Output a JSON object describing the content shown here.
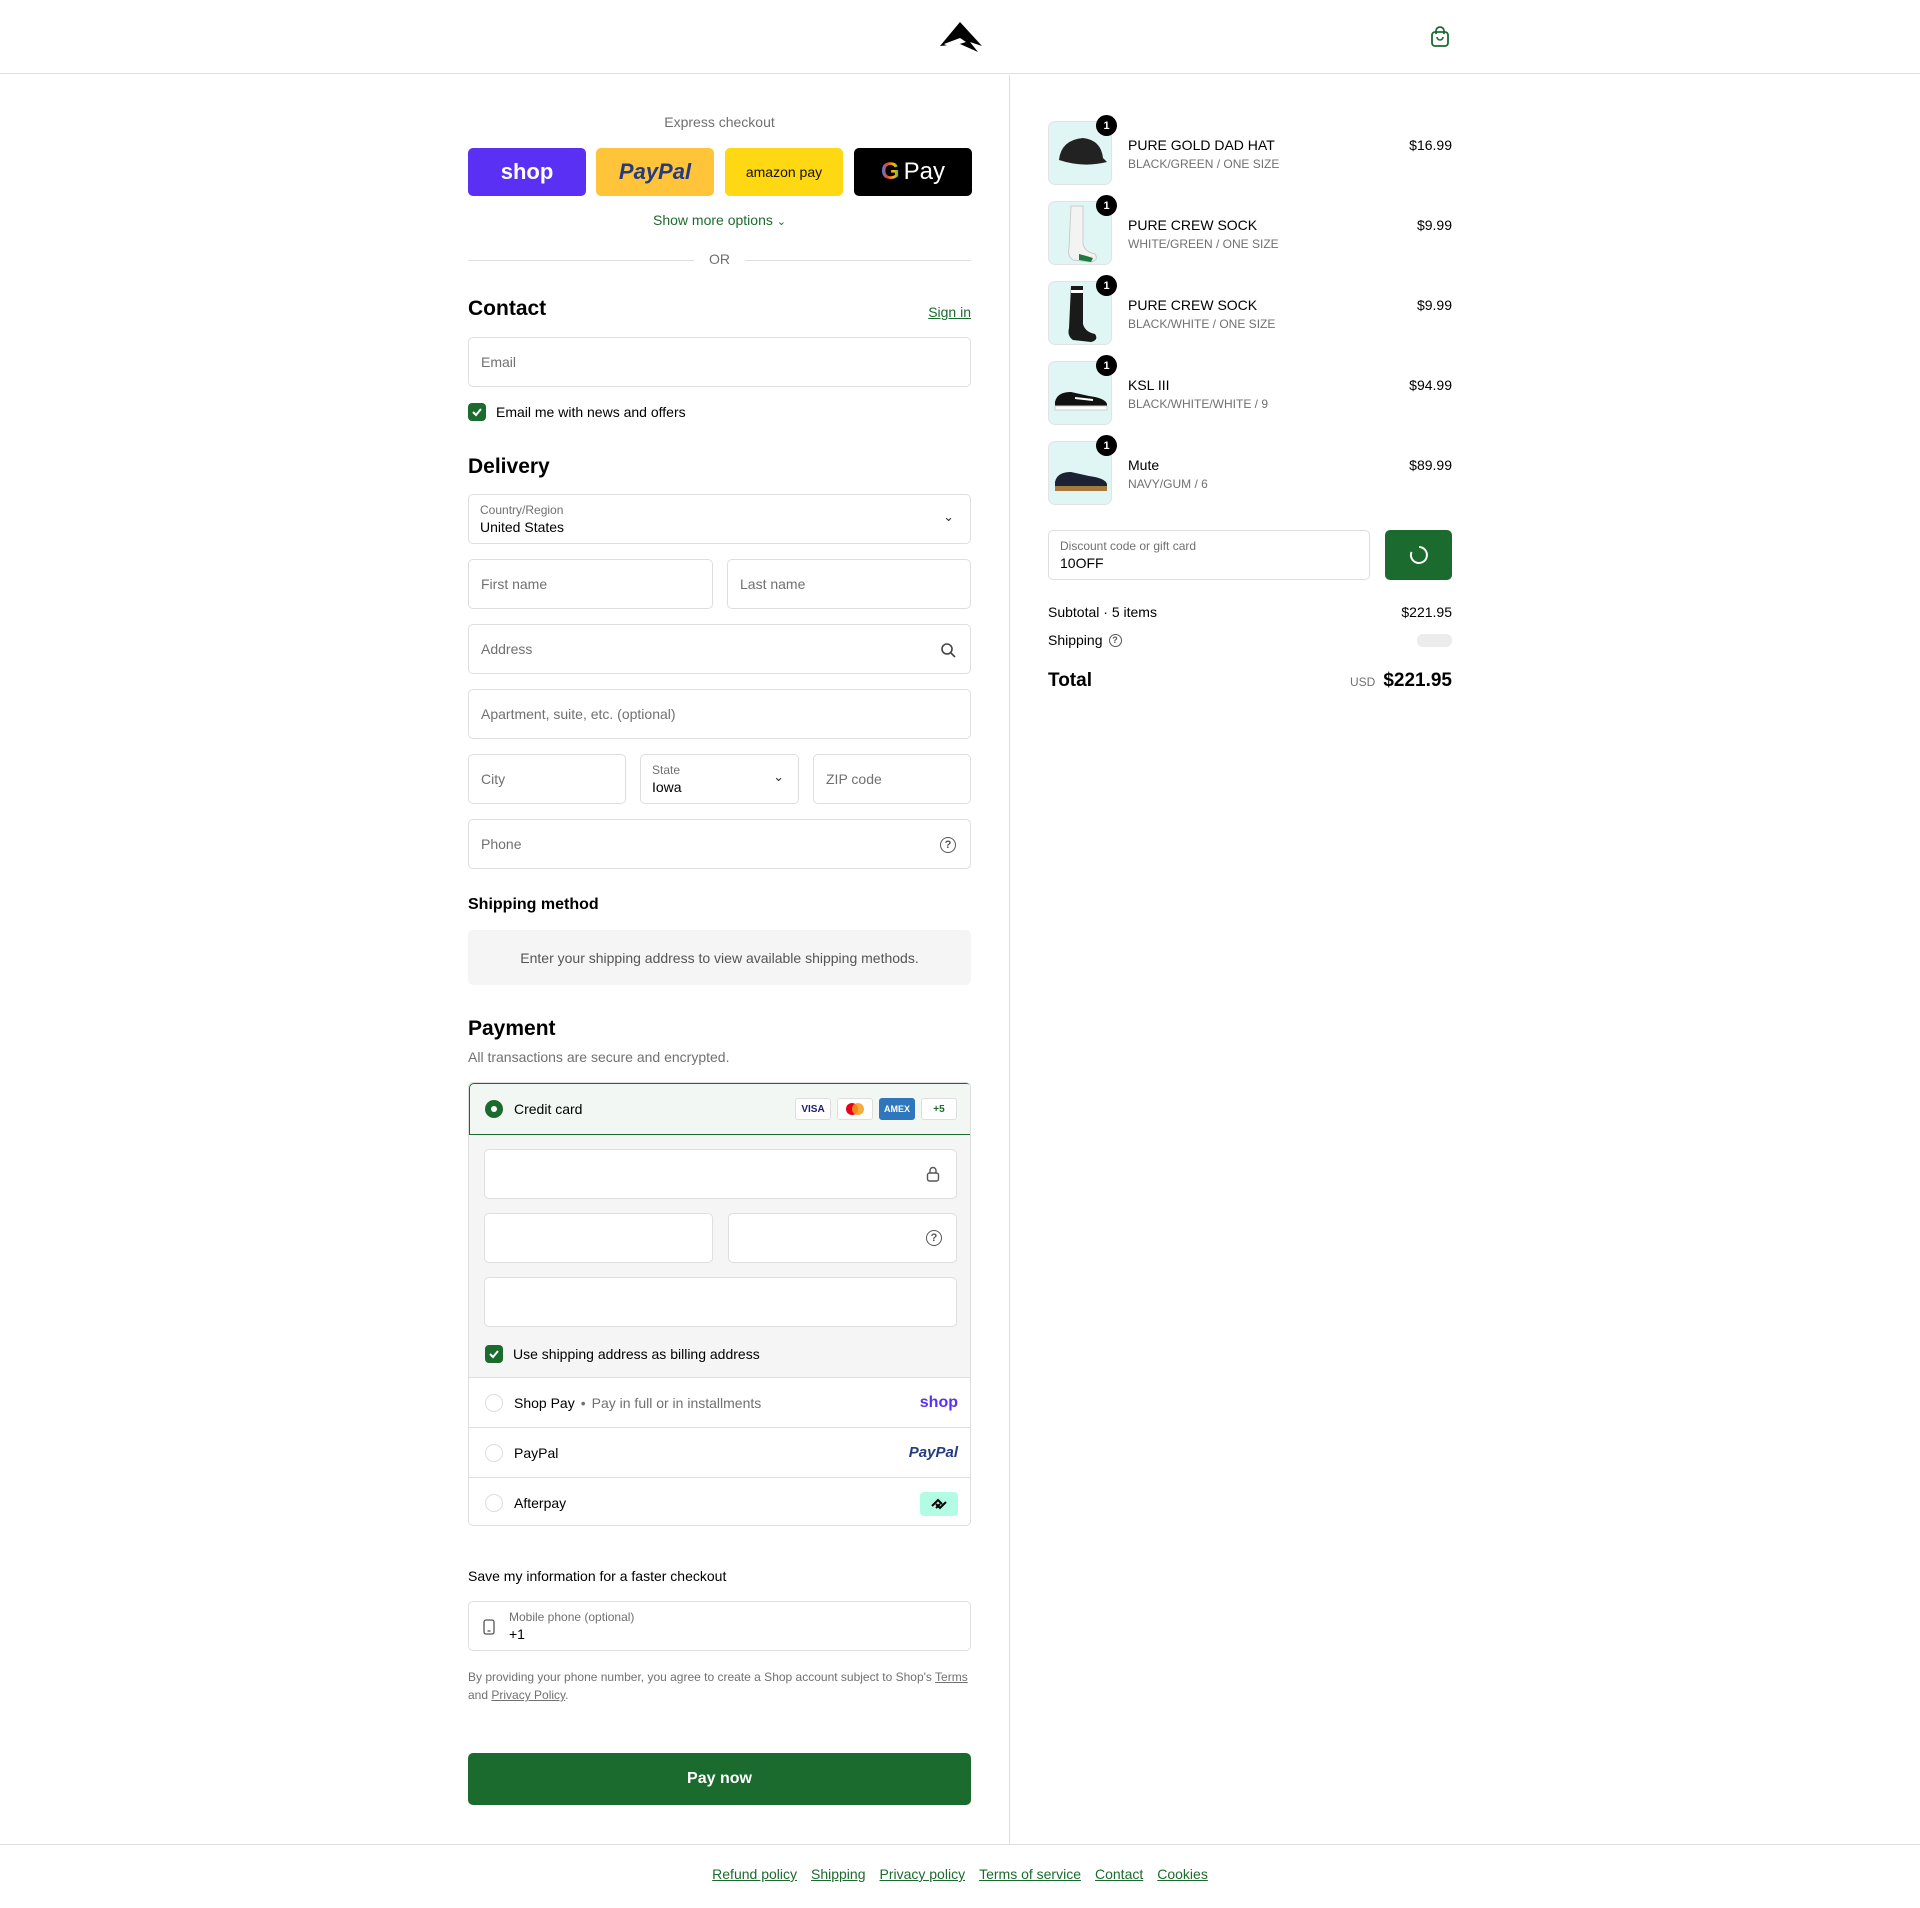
{
  "colors": {
    "accent": "#1c6b2e",
    "shop_purple": "#5a31f4",
    "paypal_yellow": "#ffc439",
    "amazon_yellow": "#ffd814",
    "thumb_bg": "#dff6f4"
  },
  "express": {
    "label": "Express checkout",
    "shop": "shop",
    "paypal": "PayPal",
    "amazon": "amazon pay",
    "gpay": "Pay",
    "more": "Show more options",
    "or": "OR"
  },
  "contact": {
    "title": "Contact",
    "sign_in": "Sign in",
    "email_placeholder": "Email",
    "news_label": "Email me with news and offers"
  },
  "delivery": {
    "title": "Delivery",
    "country_label": "Country/Region",
    "country_value": "United States",
    "first_name": "First name",
    "last_name": "Last name",
    "address": "Address",
    "apartment": "Apartment, suite, etc. (optional)",
    "city": "City",
    "state_label": "State",
    "state_value": "Iowa",
    "zip": "ZIP code",
    "phone": "Phone"
  },
  "shipping_method": {
    "title": "Shipping method",
    "message": "Enter your shipping address to view available shipping methods."
  },
  "payment": {
    "title": "Payment",
    "subtitle": "All transactions are secure and encrypted.",
    "credit_card": "Credit card",
    "card_logos": [
      "VISA",
      "",
      "AMEX",
      "+5"
    ],
    "billing_label": "Use shipping address as billing address",
    "shop_pay": "Shop Pay",
    "shop_pay_sub": "Pay in full or in installments",
    "shop_logo": "shop",
    "paypal": "PayPal",
    "paypal_logo": "PayPal",
    "afterpay": "Afterpay"
  },
  "save_info": {
    "title": "Save my information for a faster checkout",
    "phone_label": "Mobile phone (optional)",
    "phone_value": "+1",
    "legal_1": "By providing your phone number, you agree to create a Shop account subject to Shop's",
    "terms": "Terms",
    "legal_2": "and",
    "privacy": "Privacy Policy",
    "legal_3": "."
  },
  "pay_now": "Pay now",
  "footer_links": [
    "Refund policy",
    "Shipping",
    "Privacy policy",
    "Terms of service",
    "Contact",
    "Cookies"
  ],
  "cart": {
    "items": [
      {
        "name": "PURE GOLD DAD HAT",
        "variant": "BLACK/GREEN / ONE SIZE",
        "price": "$16.99",
        "qty": "1"
      },
      {
        "name": "PURE CREW SOCK",
        "variant": "WHITE/GREEN / ONE SIZE",
        "price": "$9.99",
        "qty": "1"
      },
      {
        "name": "PURE CREW SOCK",
        "variant": "BLACK/WHITE / ONE SIZE",
        "price": "$9.99",
        "qty": "1"
      },
      {
        "name": "KSL III",
        "variant": "BLACK/WHITE/WHITE / 9",
        "price": "$94.99",
        "qty": "1"
      },
      {
        "name": "Mute",
        "variant": "NAVY/GUM / 6",
        "price": "$89.99",
        "qty": "1"
      }
    ],
    "discount_label": "Discount code or gift card",
    "discount_value": "10OFF",
    "subtotal_label": "Subtotal · 5 items",
    "subtotal_value": "$221.95",
    "shipping_label": "Shipping",
    "total_label": "Total",
    "currency": "USD",
    "total_value": "$221.95"
  }
}
